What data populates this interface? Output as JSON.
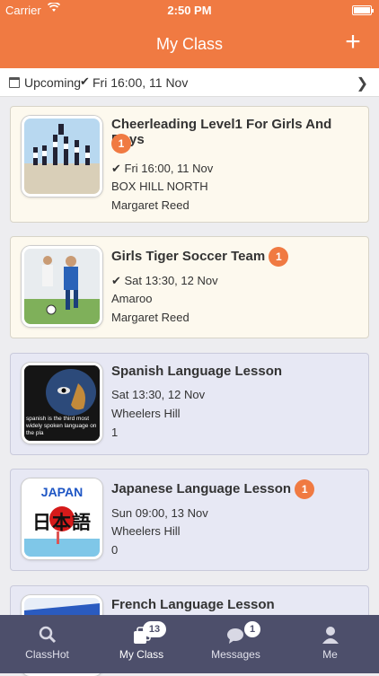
{
  "status": {
    "carrier": "Carrier",
    "time": "2:50 PM"
  },
  "nav": {
    "title": "My Class",
    "add_glyph": "+"
  },
  "upcoming": {
    "label": "Upcoming",
    "date": "Fri 16:00, 11 Nov"
  },
  "classes": [
    {
      "title": "Cheerleading Level1 For Girls And Boys",
      "badge": "1",
      "date": "Fri 16:00, 11 Nov",
      "location": "BOX HILL NORTH",
      "person": "Margaret Reed"
    },
    {
      "title": "Girls Tiger Soccer Team",
      "badge": "1",
      "date": "Sat 13:30, 12 Nov",
      "location": "Amaroo",
      "person": "Margaret Reed"
    },
    {
      "title": "Spanish Language Lesson",
      "date": "Sat 13:30, 12 Nov",
      "location": "Wheelers Hill",
      "count": "1",
      "image_text": "spanish is the third most widely spoken language on the pla"
    },
    {
      "title": "Japanese Language Lesson",
      "badge": "1",
      "date": "Sun 09:00, 13 Nov",
      "location": "Wheelers Hill",
      "count": "0",
      "image_text_top": "JAPAN",
      "image_text_kanji": "日本語"
    },
    {
      "title": "French Language Lesson"
    }
  ],
  "tabs": [
    {
      "label": "ClassHot",
      "icon": "search-icon"
    },
    {
      "label": "My Class",
      "icon": "class-icon",
      "badge": "13"
    },
    {
      "label": "Messages",
      "icon": "chat-icon",
      "badge": "1"
    },
    {
      "label": "Me",
      "icon": "person-icon"
    }
  ],
  "colors": {
    "accent": "#f07a42",
    "tabbar": "#4d4f6b"
  }
}
